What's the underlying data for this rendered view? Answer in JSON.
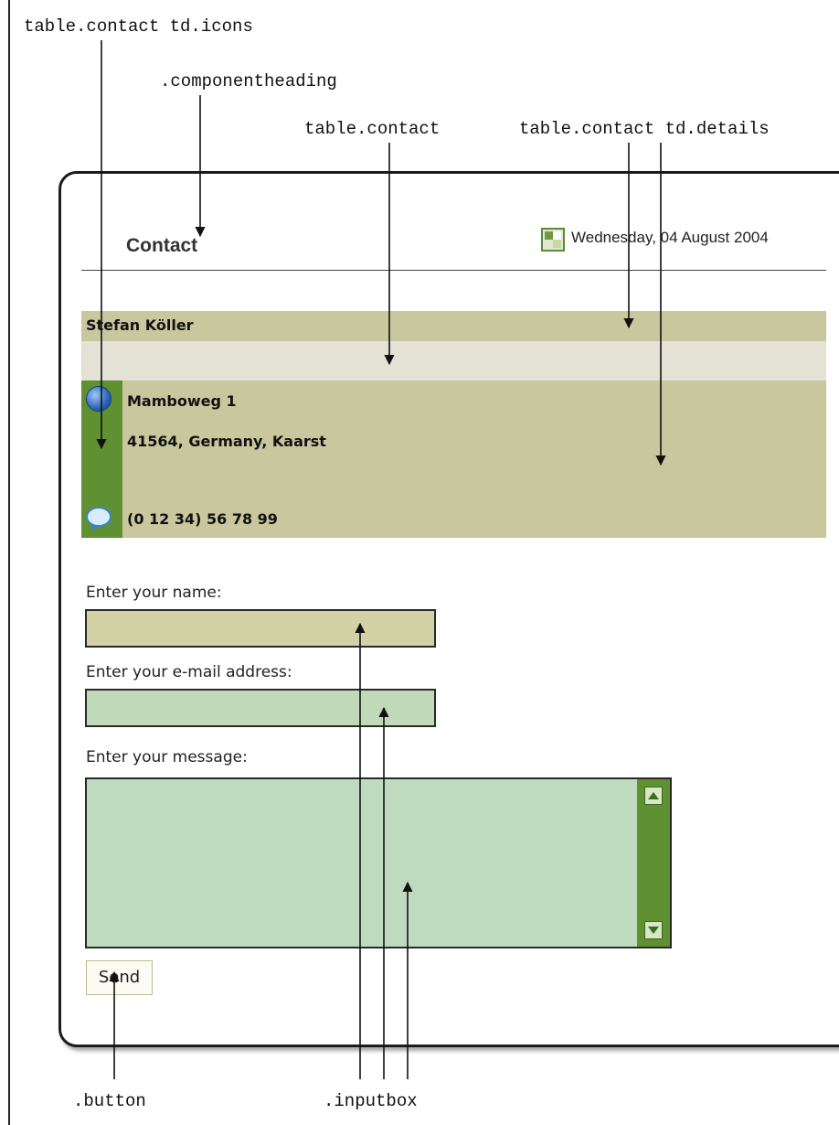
{
  "annotations": {
    "icons_cell": "table.contact td.icons",
    "componentheading": ".componentheading",
    "table_contact": "table.contact",
    "details_cell": "table.contact td.details",
    "button": ".button",
    "inputbox": ".inputbox"
  },
  "page": {
    "date": "Wednesday, 04 August 2004",
    "heading": "Contact"
  },
  "contact": {
    "name": "Stefan Köller",
    "address_line1": "Mamboweg 1",
    "address_line2": "41564, Germany, Kaarst",
    "phone": "(0 12 34) 56 78 99",
    "icons": [
      "globe-icon",
      "speech-bubble-icon"
    ]
  },
  "form": {
    "name_label": "Enter your name:",
    "name_value": "",
    "email_label": "Enter your e-mail address:",
    "email_value": "",
    "message_label": "Enter your message:",
    "message_value": "",
    "send_label": "Send"
  },
  "colors": {
    "row_olive": "#c8c79e",
    "icons_green": "#5f9132",
    "spacer_light": "#e3e2d4",
    "input_green": "#bfdbbf"
  }
}
